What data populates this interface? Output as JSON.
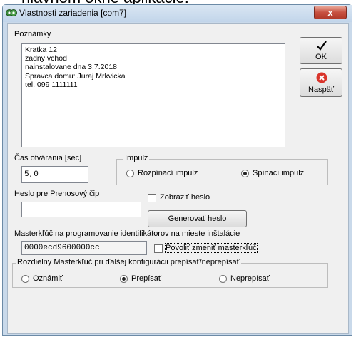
{
  "background_caption": "hlavnom okne aplikácie.",
  "window": {
    "title": "Vlastnosti zariadenia [com7]",
    "close_glyph": "x"
  },
  "notes": {
    "label": "Poznámky",
    "lines": [
      "Kratka 12",
      "zadny vchod",
      "nainstalovane dna 3.7.2018",
      "Spravca domu: Juraj Mrkvicka",
      "tel. 099 1111111"
    ]
  },
  "buttons": {
    "ok_label": "OK",
    "back_label": "Naspäť",
    "generate_label": "Generovať heslo"
  },
  "open_time": {
    "label": "Čas otvárania [sec]",
    "value": "5,0"
  },
  "impulse": {
    "legend": "Impulz",
    "option_break": "Rozpínací impulz",
    "option_make": "Spínací impulz",
    "selected": "Spínací impulz"
  },
  "password": {
    "label": "Heslo pre Prenosový čip",
    "value": "",
    "show_label": "Zobraziť heslo",
    "show_checked": false
  },
  "masterkey": {
    "label": "Masterkľúč na programovanie identifikátorov na mieste inštalácie",
    "value": "0000ecd9600000cc",
    "allow_change_label": "Povoliť zmeniť masterkľúč",
    "allow_change_checked": false
  },
  "distinguish": {
    "legend": "Rozdielny Masterkľúč pri ďalšej konfigurácii prepísať/neprepísať",
    "option_announce": "Oznámiť",
    "option_overwrite": "Prepísať",
    "option_keep": "Neprepísať",
    "selected": "Prepísať"
  },
  "colors": {
    "window_frame": "#c9d9ea",
    "close_button": "#c75040",
    "dialog_background": "#f0f0f0",
    "back_icon": "#d9342b"
  }
}
